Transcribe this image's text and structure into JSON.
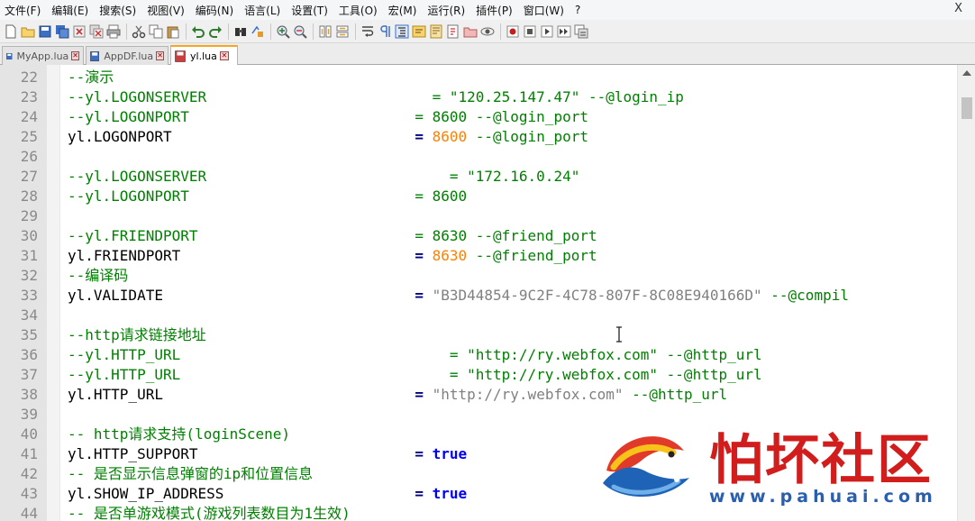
{
  "menu": {
    "items": [
      "文件(F)",
      "编辑(E)",
      "搜索(S)",
      "视图(V)",
      "编码(N)",
      "语言(L)",
      "设置(T)",
      "工具(O)",
      "宏(M)",
      "运行(R)",
      "插件(P)",
      "窗口(W)",
      "?"
    ],
    "close_label": "X"
  },
  "toolbar": {
    "icons": [
      "new-file-icon",
      "open-file-icon",
      "save-icon",
      "save-all-icon",
      "close-icon",
      "close-all-icon",
      "print-icon",
      "cut-icon",
      "copy-icon",
      "paste-icon",
      "undo-icon",
      "redo-icon",
      "find-icon",
      "replace-icon",
      "zoom-in-icon",
      "zoom-out-icon",
      "sync-v-icon",
      "sync-h-icon",
      "wrap-icon",
      "show-all-chars-icon",
      "indent-guide-icon",
      "udl-icon",
      "doc-map-icon",
      "function-list-icon",
      "folder-icon",
      "monitor-icon",
      "record-macro-icon",
      "stop-macro-icon",
      "play-macro-icon",
      "run-macro-multiple-icon",
      "save-macro-icon"
    ]
  },
  "tabs": [
    {
      "label": "MyApp.lua",
      "active": false
    },
    {
      "label": "AppDF.lua",
      "active": false
    },
    {
      "label": "yl.lua",
      "active": true
    }
  ],
  "editor": {
    "lines": [
      {
        "n": "22",
        "segs": [
          {
            "t": "--演示",
            "c": "com"
          }
        ]
      },
      {
        "n": "23",
        "segs": [
          {
            "t": "--yl.LOGONSERVER                          = \"120.25.147.47\" --@login_ip",
            "c": "com"
          }
        ]
      },
      {
        "n": "24",
        "segs": [
          {
            "t": "--yl.LOGONPORT                          = 8600 --@login_port",
            "c": "com"
          }
        ]
      },
      {
        "n": "25",
        "segs": [
          {
            "t": "yl.LOGONPORT                            ",
            "c": ""
          },
          {
            "t": "=",
            "c": "op"
          },
          {
            "t": " ",
            "c": ""
          },
          {
            "t": "8600",
            "c": "num"
          },
          {
            "t": " --@login_port",
            "c": "com"
          }
        ]
      },
      {
        "n": "26",
        "segs": []
      },
      {
        "n": "27",
        "segs": [
          {
            "t": "--yl.LOGONSERVER                            = \"172.16.0.24\"",
            "c": "com"
          }
        ]
      },
      {
        "n": "28",
        "segs": [
          {
            "t": "--yl.LOGONPORT                          = 8600",
            "c": "com"
          }
        ]
      },
      {
        "n": "29",
        "segs": []
      },
      {
        "n": "30",
        "segs": [
          {
            "t": "--yl.FRIENDPORT                         = 8630 --@friend_port",
            "c": "com"
          }
        ]
      },
      {
        "n": "31",
        "segs": [
          {
            "t": "yl.FRIENDPORT                           ",
            "c": ""
          },
          {
            "t": "=",
            "c": "op"
          },
          {
            "t": " ",
            "c": ""
          },
          {
            "t": "8630",
            "c": "num"
          },
          {
            "t": " --@friend_port",
            "c": "com"
          }
        ]
      },
      {
        "n": "32",
        "segs": [
          {
            "t": "--编译码",
            "c": "com"
          }
        ]
      },
      {
        "n": "33",
        "segs": [
          {
            "t": "yl.VALIDATE                             ",
            "c": ""
          },
          {
            "t": "=",
            "c": "op"
          },
          {
            "t": " ",
            "c": ""
          },
          {
            "t": "\"B3D44854-9C2F-4C78-807F-8C08E940166D\"",
            "c": "str"
          },
          {
            "t": " --@compil",
            "c": "com"
          }
        ]
      },
      {
        "n": "34",
        "segs": []
      },
      {
        "n": "35",
        "segs": [
          {
            "t": "--http请求链接地址",
            "c": "com"
          }
        ]
      },
      {
        "n": "36",
        "segs": [
          {
            "t": "--yl.HTTP_URL                               = \"http://ry.webfox.com\" --@http_url",
            "c": "com"
          }
        ]
      },
      {
        "n": "37",
        "segs": [
          {
            "t": "--yl.HTTP_URL                               = \"http://ry.webfox.com\" --@http_url",
            "c": "com"
          }
        ]
      },
      {
        "n": "38",
        "segs": [
          {
            "t": "yl.HTTP_URL                             ",
            "c": ""
          },
          {
            "t": "=",
            "c": "op"
          },
          {
            "t": " ",
            "c": ""
          },
          {
            "t": "\"http://ry.webfox.com\"",
            "c": "str"
          },
          {
            "t": " --@http_url",
            "c": "com"
          }
        ]
      },
      {
        "n": "39",
        "segs": []
      },
      {
        "n": "40",
        "segs": [
          {
            "t": "-- http请求支持(loginScene)",
            "c": "com"
          }
        ]
      },
      {
        "n": "41",
        "segs": [
          {
            "t": "yl.HTTP_SUPPORT                         ",
            "c": ""
          },
          {
            "t": "=",
            "c": "op"
          },
          {
            "t": " ",
            "c": ""
          },
          {
            "t": "true",
            "c": "kw"
          }
        ]
      },
      {
        "n": "42",
        "segs": [
          {
            "t": "-- 是否显示信息弹窗的ip和位置信息",
            "c": "com"
          }
        ]
      },
      {
        "n": "43",
        "segs": [
          {
            "t": "yl.SHOW_IP_ADDRESS                      ",
            "c": ""
          },
          {
            "t": "=",
            "c": "op"
          },
          {
            "t": " ",
            "c": ""
          },
          {
            "t": "true",
            "c": "kw"
          }
        ]
      },
      {
        "n": "44",
        "segs": [
          {
            "t": "-- 是否单游戏模式(游戏列表数目为1生效)",
            "c": "com"
          }
        ]
      }
    ]
  },
  "colors": {
    "comment": "#008000",
    "number": "#ff8000",
    "string": "#808080",
    "keyword": "#0000ff",
    "operator": "#000080",
    "active_tab_accent": "#f5a623"
  },
  "watermark": {
    "brand": "怕坏社区",
    "url": "www.pahuai.com"
  }
}
